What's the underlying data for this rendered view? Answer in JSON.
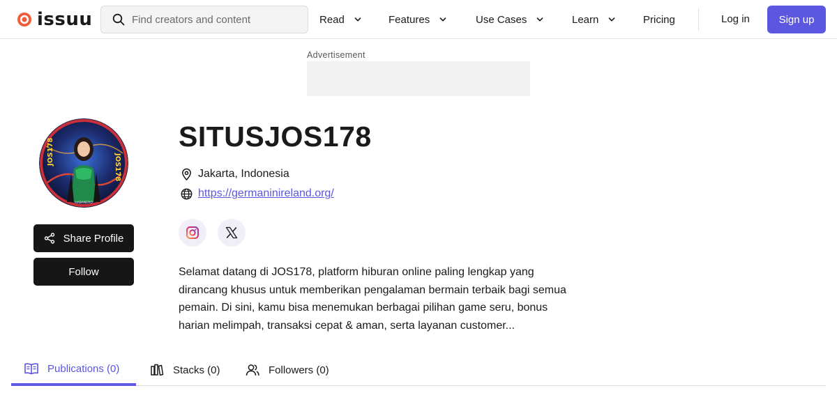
{
  "header": {
    "logo_text": "issuu",
    "search": {
      "placeholder": "Find creators and content",
      "value": ""
    },
    "nav": [
      {
        "label": "Read",
        "has_dropdown": true
      },
      {
        "label": "Features",
        "has_dropdown": true
      },
      {
        "label": "Use Cases",
        "has_dropdown": true
      },
      {
        "label": "Learn",
        "has_dropdown": true
      },
      {
        "label": "Pricing",
        "has_dropdown": false
      }
    ],
    "login_label": "Log in",
    "signup_label": "Sign up"
  },
  "ad": {
    "label": "Advertisement"
  },
  "profile": {
    "name": "SITUSJOS178",
    "location": "Jakarta, Indonesia",
    "website": "https://germaninireland.org/",
    "avatar_text": [
      "JOS178",
      "JOS178",
      "HABANERO"
    ],
    "socials": [
      {
        "icon": "instagram-icon"
      },
      {
        "icon": "x-twitter-icon"
      }
    ],
    "bio": "Selamat datang di JOS178, platform hiburan online paling lengkap yang dirancang khusus untuk memberikan pengalaman bermain terbaik bagi semua pemain. Di sini, kamu bisa menemukan berbagai pilihan game seru, bonus harian melimpah, transaksi cepat & aman, serta layanan customer..."
  },
  "actions": {
    "share_label": "Share Profile",
    "follow_label": "Follow"
  },
  "tabs": [
    {
      "label": "Publications (0)",
      "icon": "book-open-icon",
      "active": true
    },
    {
      "label": "Stacks (0)",
      "icon": "stacks-icon",
      "active": false
    },
    {
      "label": "Followers (0)",
      "icon": "followers-icon",
      "active": false
    }
  ],
  "colors": {
    "accent": "#5b57e0",
    "brand_logo": "#f25a3a",
    "button_dark": "#161616"
  }
}
